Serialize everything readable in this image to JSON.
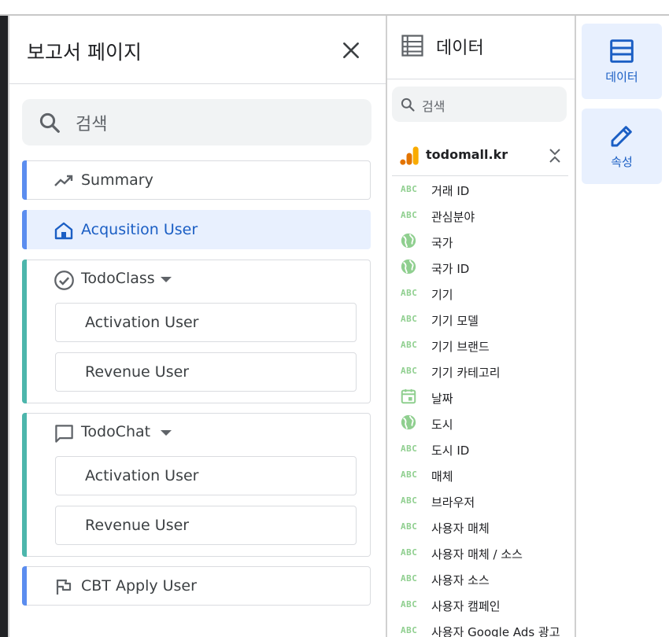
{
  "report_pages": {
    "title": "보고서 페이지",
    "search_placeholder": "검색",
    "items": [
      {
        "label": "Summary",
        "icon": "trending-up-icon",
        "bar_color": "#5b8def",
        "active": false
      },
      {
        "label": "Acqusition User",
        "icon": "home-icon",
        "bar_color": "#5b8def",
        "active": true
      }
    ],
    "groups": [
      {
        "label": "TodoClass",
        "icon": "check-circle-icon",
        "children": [
          "Activation User",
          "Revenue User"
        ]
      },
      {
        "label": "TodoChat",
        "icon": "chat-bubble-icon",
        "children": [
          "Activation User",
          "Revenue User"
        ]
      }
    ],
    "last_item": {
      "label": "CBT Apply User",
      "icon": "flag-icon",
      "bar_color": "#5b8def"
    }
  },
  "data_panel": {
    "title": "데이터",
    "search_placeholder": "검색",
    "source": {
      "name": "todomall.kr",
      "icon": "google-analytics-icon"
    },
    "fields": [
      {
        "name": "거래 ID",
        "type": "abc"
      },
      {
        "name": "관심분야",
        "type": "abc"
      },
      {
        "name": "국가",
        "type": "geo"
      },
      {
        "name": "국가 ID",
        "type": "geo"
      },
      {
        "name": "기기",
        "type": "abc"
      },
      {
        "name": "기기 모델",
        "type": "abc"
      },
      {
        "name": "기기 브랜드",
        "type": "abc"
      },
      {
        "name": "기기 카테고리",
        "type": "abc"
      },
      {
        "name": "날짜",
        "type": "date"
      },
      {
        "name": "도시",
        "type": "geo"
      },
      {
        "name": "도시 ID",
        "type": "abc"
      },
      {
        "name": "매체",
        "type": "abc"
      },
      {
        "name": "브라우저",
        "type": "abc"
      },
      {
        "name": "사용자 매체",
        "type": "abc"
      },
      {
        "name": "사용자 매체 / 소스",
        "type": "abc"
      },
      {
        "name": "사용자 소스",
        "type": "abc"
      },
      {
        "name": "사용자 캠페인",
        "type": "abc"
      },
      {
        "name": "사용자 Google Ads 광고",
        "type": "abc"
      }
    ],
    "type_label_abc": "ABC"
  },
  "rail": {
    "data_label": "데이터",
    "properties_label": "속성"
  },
  "colors": {
    "accent": "#1a5ec4",
    "active_bg": "#e8f0fe",
    "group_bar": "#4db6ac",
    "page_bar": "#5b8def",
    "abc_green": "#8fcf8f"
  }
}
